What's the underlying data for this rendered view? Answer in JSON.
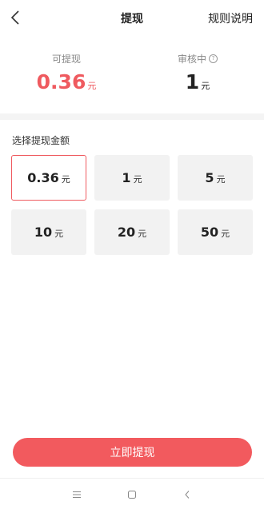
{
  "header": {
    "title": "提现",
    "rules_label": "规则说明"
  },
  "summary": {
    "available": {
      "label": "可提现",
      "value": "0.36",
      "unit": "元",
      "color": "#ef5a5f"
    },
    "pending": {
      "label": "审核中",
      "value": "1",
      "unit": "元"
    }
  },
  "section_label": "选择提现金额",
  "amounts": [
    {
      "value": "0.36",
      "unit": "元",
      "selected": true
    },
    {
      "value": "1",
      "unit": "元",
      "selected": false
    },
    {
      "value": "5",
      "unit": "元",
      "selected": false
    },
    {
      "value": "10",
      "unit": "元",
      "selected": false
    },
    {
      "value": "20",
      "unit": "元",
      "selected": false
    },
    {
      "value": "50",
      "unit": "元",
      "selected": false
    }
  ],
  "withdraw_button_label": "立即提现",
  "colors": {
    "accent": "#f25a5e",
    "tile_bg": "#f2f2f2"
  },
  "icons": {
    "back": "chevron-left-icon",
    "help": "question-circle-icon",
    "nav_menu": "menu-icon",
    "nav_home": "square-icon",
    "nav_back": "back-icon"
  }
}
